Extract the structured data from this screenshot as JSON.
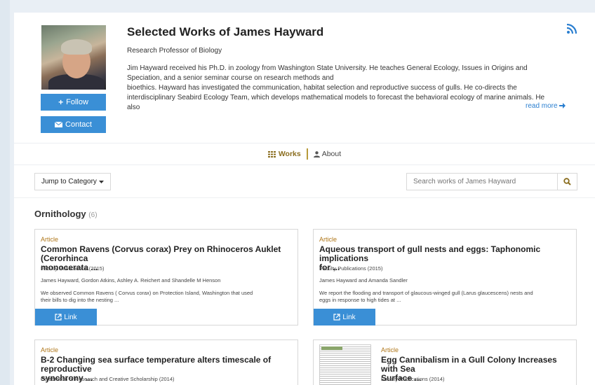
{
  "profile": {
    "name": "Selected Works of James Hayward",
    "title": "Research Professor of Biology",
    "bio_lines": [
      "Jim Hayward received his Ph.D. in zoology from Washington State University. He teaches General Ecology, Issues in Origins and",
      "Speciation, and a senior seminar course on research methods and",
      "bioethics. Hayward has investigated the communication, habitat selection and reproductive success of gulls. He co-directs the",
      "interdisciplinary Seabird Ecology Team, which develops mathematical models to forecast the behavioral ecology of marine animals. He",
      "also"
    ],
    "read_more": "read more",
    "follow_label": "Follow",
    "contact_label": "Contact"
  },
  "tabs": {
    "works": "Works",
    "about": "About"
  },
  "controls": {
    "jump_label": "Jump to Category",
    "search_placeholder": "Search works of James Hayward"
  },
  "category": {
    "name": "Ornithology",
    "count": "(6)"
  },
  "cards": [
    {
      "type": "Article",
      "title_lines": [
        "Common Ravens (Corvus corax) Prey on Rhinoceros Auklet (Cerorhinca",
        "monocerata ..."
      ],
      "publication": "Faculty Publications (2015)",
      "authors": "James Hayward, Gordon Atkins, Ashley A. Reichert and Shandelle M Henson",
      "abstract_lines": [
        "We observed Common Ravens ( Corvus corax) on Protection Island, Washington that used",
        "their bills to dig into the nesting ..."
      ],
      "link_label": "Link"
    },
    {
      "type": "Article",
      "title_lines": [
        "Aqueous transport of gull nests and eggs: Taphonomic implications",
        "for ..."
      ],
      "publication": "Faculty Publications (2015)",
      "authors": "James Hayward and Amanda Sandler",
      "abstract_lines": [
        "We report the flooding and transport of glaucous-winged gull (Larus glaucescens) nests and",
        "eggs in response to high tides at ..."
      ],
      "link_label": "Link"
    },
    {
      "type": "Article",
      "title_lines": [
        "B-2 Changing sea surface temperature alters timescale of reproductive",
        "synchrony ..."
      ],
      "publication": "Celebration of Research and Creative Scholarship (2014)"
    },
    {
      "type": "Article",
      "title_lines": [
        "Egg Cannibalism in a Gull Colony Increases with Sea",
        "Surface ..."
      ],
      "publication": "Faculty Publications (2014)"
    }
  ],
  "colors": {
    "accent": "#3a8fd6",
    "type_label": "#b0771a",
    "works_tab": "#8a6d1e"
  }
}
